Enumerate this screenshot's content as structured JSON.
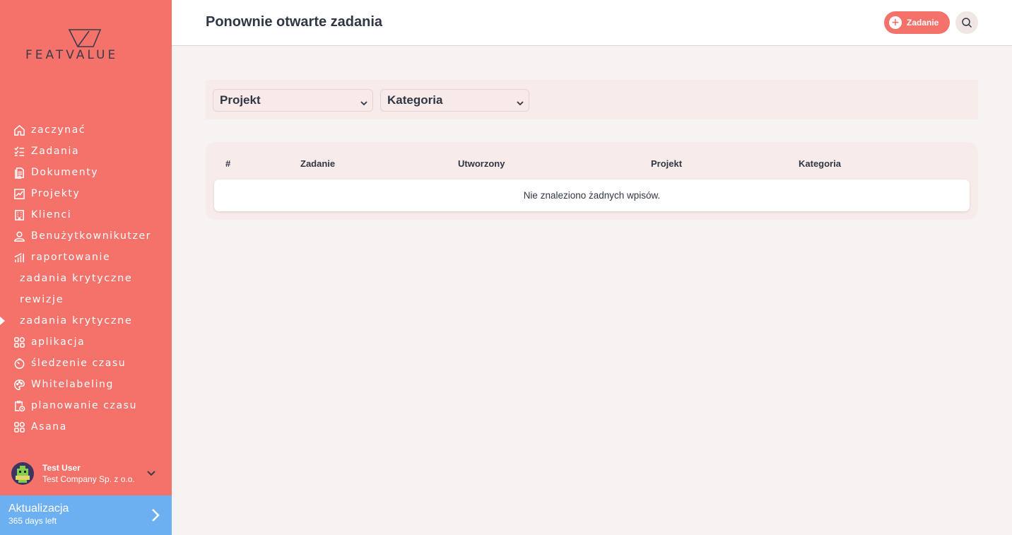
{
  "brand": {
    "logo_text": "FEATVALUE",
    "accent": "#f4726a",
    "update_color": "#6db0f2"
  },
  "header": {
    "title": "Ponownie otwarte zadania",
    "add_label": "Zadanie"
  },
  "sidebar": {
    "items": [
      {
        "label": "zaczynać",
        "icon": "home-icon"
      },
      {
        "label": "Zadania",
        "icon": "checklist-icon"
      },
      {
        "label": "Dokumenty",
        "icon": "document-icon"
      },
      {
        "label": "Projekty",
        "icon": "chart-icon"
      },
      {
        "label": "Klienci",
        "icon": "building-icon"
      },
      {
        "label": "Benużytkownikutzer",
        "icon": "user-icon"
      },
      {
        "label": "raportowanie",
        "icon": "report-icon"
      },
      {
        "label": "zadania krytyczne",
        "icon": ""
      },
      {
        "label": "rewizje",
        "icon": ""
      },
      {
        "label": "zadania krytyczne",
        "icon": "",
        "active": true
      },
      {
        "label": "aplikacja",
        "icon": "apps-icon"
      },
      {
        "label": "śledzenie czasu",
        "icon": "timer-icon"
      },
      {
        "label": "Whitelabeling",
        "icon": "palette-icon"
      },
      {
        "label": "planowanie czasu",
        "icon": "clipboard-clock-icon"
      },
      {
        "label": "Asana",
        "icon": "apps-icon"
      }
    ]
  },
  "user": {
    "name": "Test User",
    "company": "Test Company Sp. z o.o."
  },
  "update": {
    "title": "Aktualizacja",
    "subtitle": "365 days left"
  },
  "filters": {
    "project": "Projekt",
    "category": "Kategoria"
  },
  "table": {
    "columns": [
      "#",
      "Zadanie",
      "Utworzony",
      "Projekt",
      "Kategoria"
    ],
    "empty_message": "Nie znaleziono żadnych wpisów."
  }
}
